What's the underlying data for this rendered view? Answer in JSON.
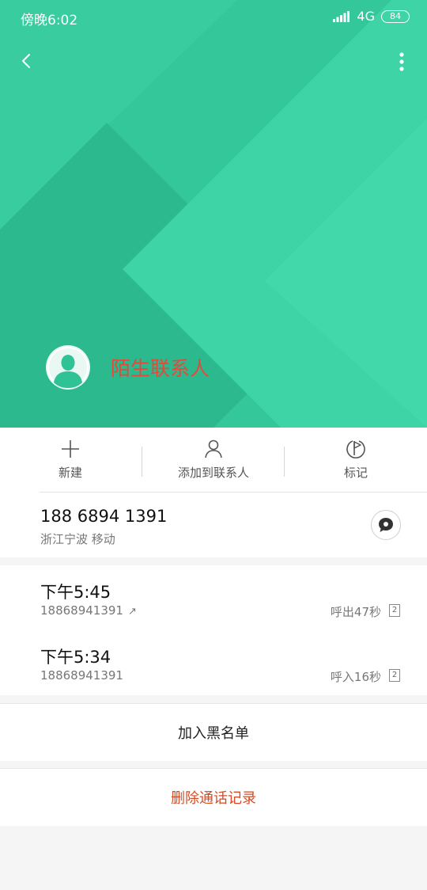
{
  "status_bar": {
    "time": "傍晚6:02",
    "network": "4G",
    "battery": "84"
  },
  "header": {
    "contact_name": "陌生联系人",
    "name_color": "#e8483a",
    "bg_color": "#33c799"
  },
  "actions": {
    "new_label": "新建",
    "add_contact_label": "添加到联系人",
    "mark_label": "标记"
  },
  "phone": {
    "number": "188 6894 1391",
    "location": "浙江宁波 移动"
  },
  "calls": [
    {
      "time": "下午5:45",
      "number": "18868941391",
      "direction_icon": "↗",
      "duration": "呼出47秒",
      "sim": "2"
    },
    {
      "time": "下午5:34",
      "number": "18868941391",
      "duration": "呼入16秒",
      "sim": "2"
    }
  ],
  "buttons": {
    "blacklist": "加入黑名单",
    "delete_log": "删除通话记录",
    "delete_color": "#d64b23"
  }
}
